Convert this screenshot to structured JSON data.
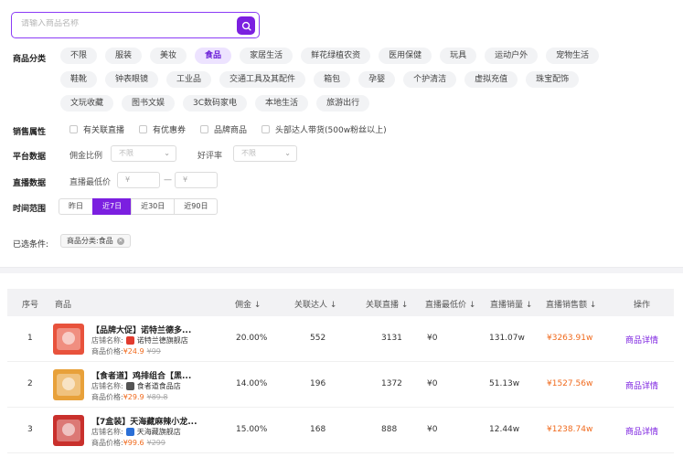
{
  "search": {
    "placeholder": "请输入商品名称"
  },
  "filters": {
    "category_label": "商品分类",
    "categories": [
      "不限",
      "服装",
      "美妆",
      "食品",
      "家居生活",
      "鲜花绿植农资",
      "医用保健",
      "玩具",
      "运动户外",
      "宠物生活",
      "鞋靴",
      "钟表眼镜",
      "工业品",
      "交通工具及其配件",
      "箱包",
      "孕婴",
      "个护清洁",
      "虚拟充值",
      "珠宝配饰",
      "文玩收藏",
      "图书文娱",
      "3C数码家电",
      "本地生活",
      "旅游出行"
    ],
    "active_category": "食品",
    "sales_label": "销售属性",
    "sales_options": [
      "有关联直播",
      "有优惠券",
      "品牌商品",
      "头部达人带货(500w粉丝以上)"
    ],
    "platform_label": "平台数据",
    "commission_label": "佣金比例",
    "commission_value": "不限",
    "rating_label": "好评率",
    "rating_value": "不限",
    "live_label": "直播数据",
    "live_min_price_label": "直播最低价",
    "price_from_placeholder": "¥",
    "price_dash": "—",
    "price_to_placeholder": "¥",
    "time_label": "时间范围",
    "time_options": [
      "昨日",
      "近7日",
      "近30日",
      "近90日"
    ],
    "active_time": "近7日",
    "selected_label": "已选条件:",
    "selected_tag": "商品分类:食品"
  },
  "table": {
    "headers": {
      "index": "序号",
      "product": "商品",
      "commission": "佣金",
      "influencers": "关联达人",
      "lives": "关联直播",
      "min_price": "直播最低价",
      "sales": "直播销量",
      "revenue": "直播销售额",
      "action": "操作"
    },
    "sort_arrow": "↓",
    "store_prefix": "店铺名称:",
    "price_prefix": "商品价格:",
    "rows": [
      {
        "index": "1",
        "name": "【品牌大促】诺特兰德多...",
        "store": "诺特兰德旗舰店",
        "store_color": "#e23b2e",
        "price": "¥24.9",
        "old_price": "¥99",
        "commission": "20.00%",
        "influencers": "552",
        "lives": "3131",
        "min_price": "¥0",
        "sales": "131.07w",
        "revenue": "¥3263.91w",
        "action": "商品详情",
        "thumb_color": "#e8523c"
      },
      {
        "index": "2",
        "name": "【食者道】鸡排组合【黑...",
        "store": "食者道食品店",
        "store_color": "#555555",
        "price": "¥29.9",
        "old_price": "¥89.8",
        "commission": "14.00%",
        "influencers": "196",
        "lives": "1372",
        "min_price": "¥0",
        "sales": "51.13w",
        "revenue": "¥1527.56w",
        "action": "商品详情",
        "thumb_color": "#e8a13a"
      },
      {
        "index": "3",
        "name": "【7盒装】天海藏麻辣小龙...",
        "store": "天海藏旗舰店",
        "store_color": "#2b6fd6",
        "price": "¥99.6",
        "old_price": "¥299",
        "commission": "15.00%",
        "influencers": "168",
        "lives": "888",
        "min_price": "¥0",
        "sales": "12.44w",
        "revenue": "¥1238.74w",
        "action": "商品详情",
        "thumb_color": "#c9302c"
      }
    ]
  },
  "colors": {
    "accent": "#7b1fe0",
    "price": "#f06a1d"
  }
}
